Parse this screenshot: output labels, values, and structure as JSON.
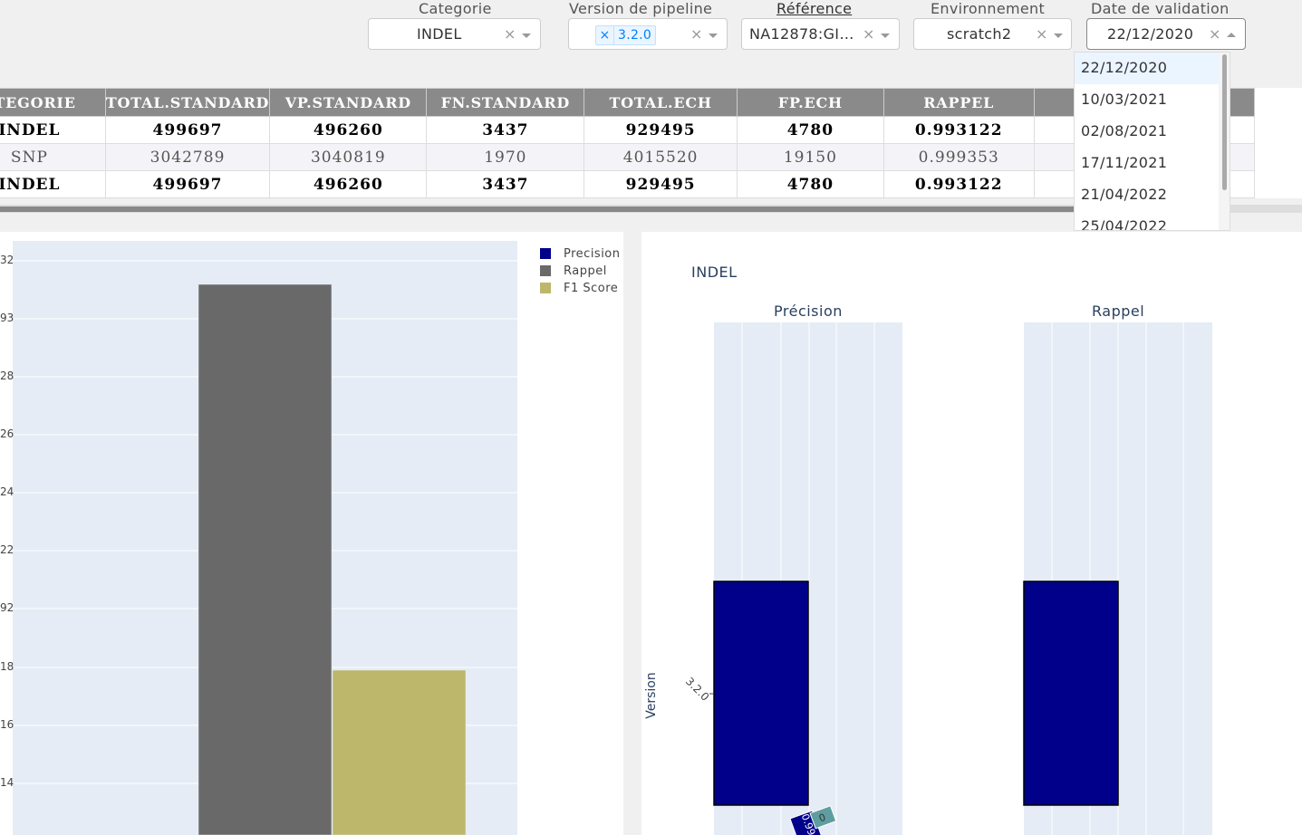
{
  "filters": {
    "categorie": {
      "label": "Categorie",
      "value": "INDEL"
    },
    "version": {
      "label": "Version de pipeline",
      "tag": "3.2.0"
    },
    "reference": {
      "label": "Référence",
      "value": "NA12878:GI…"
    },
    "environnement": {
      "label": "Environnement",
      "value": "scratch2"
    },
    "date": {
      "label": "Date de validation",
      "value": "22/12/2020"
    },
    "clear_glyph": "×"
  },
  "date_options": [
    "22/12/2020",
    "10/03/2021",
    "02/08/2021",
    "17/11/2021",
    "21/04/2022",
    "25/04/2022"
  ],
  "table": {
    "columns": [
      "ATEGORIE",
      "TOTAL.STANDARD",
      "VP.STANDARD",
      "FN.STANDARD",
      "TOTAL.ECH",
      "FP.ECH",
      "RAPPEL",
      "",
      ""
    ],
    "rows": [
      {
        "style": "bold",
        "cells": [
          "INDEL",
          "499697",
          "496260",
          "3437",
          "929495",
          "4780",
          "0.993122",
          "",
          "("
        ]
      },
      {
        "style": "norm",
        "cells": [
          "SNP",
          "3042789",
          "3040819",
          "1970",
          "4015520",
          "19150",
          "0.999353",
          "",
          ""
        ]
      },
      {
        "style": "bold",
        "cells": [
          "INDEL",
          "499697",
          "496260",
          "3437",
          "929495",
          "4780",
          "0.993122",
          "",
          "("
        ]
      }
    ]
  },
  "chart_left": {
    "legend": [
      {
        "name": "Precision",
        "color": "#00008b"
      },
      {
        "name": "Rappel",
        "color": "#696969"
      },
      {
        "name": "F1 Score",
        "color": "#bdb76b"
      }
    ],
    "y_ticks": [
      "32",
      "93",
      "28",
      "26",
      "24",
      "22",
      "92",
      "18",
      "16",
      "14"
    ]
  },
  "chart_right": {
    "title": "INDEL",
    "subplots": [
      "Précision",
      "Rappel"
    ],
    "ylabel": "Version",
    "ytick": "3.2.0",
    "bar_label_a": "0.99",
    "bar_label_b": "0"
  },
  "chart_data": [
    {
      "type": "bar",
      "categories": [
        "3.2.0"
      ],
      "series": [
        {
          "name": "Precision",
          "values": [
            null
          ]
        },
        {
          "name": "Rappel",
          "values": [
            0.993122
          ]
        },
        {
          "name": "F1 Score",
          "values": [
            null
          ]
        }
      ],
      "legend": "top-right",
      "grid": true
    },
    {
      "type": "bar",
      "title": "INDEL",
      "subplots": [
        "Précision",
        "Rappel"
      ],
      "ylabel": "Version",
      "categories": [
        "3.2.0"
      ],
      "grid": true
    }
  ]
}
